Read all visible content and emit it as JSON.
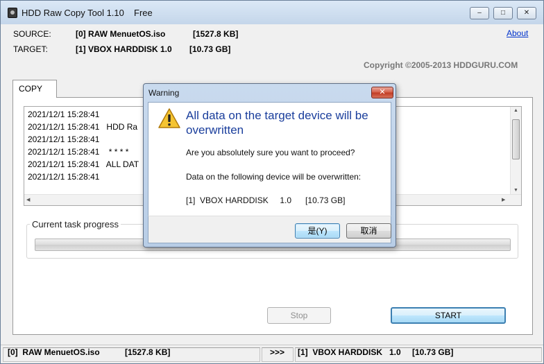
{
  "window": {
    "title": "HDD Raw Copy Tool 1.10",
    "edition": "Free",
    "controls": {
      "minimize": "–",
      "maximize": "□",
      "close": "✕"
    }
  },
  "header": {
    "source_label": "SOURCE:",
    "source_value": "[0]  RAW MenuetOS.iso",
    "source_size": "[1527.8 KB]",
    "target_label": "TARGET:",
    "target_value": "[1]  VBOX HARDDISK   1.0",
    "target_size": "[10.73 GB]",
    "about_link": "About",
    "copyright": "Copyright ©2005-2013 HDDGURU.COM"
  },
  "tabs": [
    {
      "label": "COPY",
      "selected": true
    }
  ],
  "log": {
    "lines": [
      "2021/12/1 15:28:41",
      "2021/12/1 15:28:41   HDD Ra",
      "2021/12/1 15:28:41",
      "2021/12/1 15:28:41    * * * *",
      "2021/12/1 15:28:41   ALL DAT",
      "2021/12/1 15:28:41"
    ]
  },
  "progress": {
    "label": "Current task progress",
    "value_fraction": 0.0
  },
  "buttons": {
    "stop": "Stop",
    "start": "START"
  },
  "statusbar": {
    "source": "[0]  RAW MenuetOS.iso",
    "source_size": "[1527.8 KB]",
    "arrow": ">>>",
    "target": "[1]  VBOX HARDDISK   1.0",
    "target_size": "[10.73 GB]"
  },
  "dialog": {
    "title": "Warning",
    "close": "✕",
    "heading": "All data on the target device will be overwritten",
    "question": "Are you absolutely sure you want to proceed?",
    "info": "Data on the following device will be overwritten:",
    "device": "[1]  VBOX HARDDISK     1.0      [10.73 GB]",
    "yes_button": "是(Y)",
    "cancel_button": "取消",
    "icon": "warning-triangle-icon"
  },
  "colors": {
    "heading_blue": "#1a3e9c",
    "link_blue": "#0033cc",
    "window_frame": "#c4d6ea",
    "close_red": "#c03a22"
  }
}
